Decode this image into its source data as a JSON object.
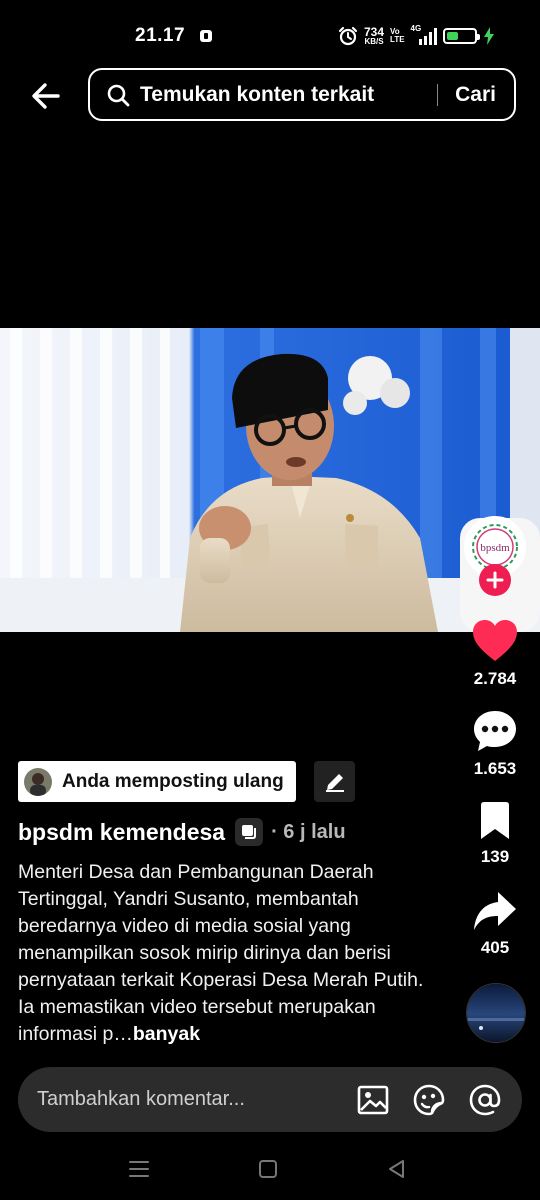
{
  "status_bar": {
    "time": "21.17",
    "net_speed_value": "734",
    "net_speed_unit": "KB/S",
    "volte_top": "Vo",
    "volte_bottom": "LTE",
    "network": "4G",
    "battery_level": 0.45,
    "battery_color": "#3fd35a",
    "icons": [
      "app-notification-icon",
      "alarm-icon",
      "signal-icon",
      "battery-icon",
      "charging-icon"
    ]
  },
  "search": {
    "text": "Temukan konten terkait",
    "button_label": "Cari"
  },
  "profile": {
    "avatar_text": "bpsdm"
  },
  "actions": {
    "likes": "2.784",
    "comments": "1.653",
    "saves": "139",
    "shares": "405"
  },
  "post": {
    "repost_label": "Anda memposting ulang",
    "username": "bpsdm kemendesa",
    "time_ago": "· 6 j lalu",
    "caption": "Menteri Desa dan Pembangunan Daerah Tertinggal, Yandri Susanto, membantah beredarnya video di media sosial yang menampilkan sosok mirip dirinya dan berisi pernyataan terkait Koperasi Desa Merah Putih. Ia memastikan video tersebut merupakan informasi p…",
    "more_label": "banyak"
  },
  "comment": {
    "placeholder": "Tambahkan komentar..."
  },
  "colors": {
    "like_red": "#fe2c55",
    "follow_pink": "#ee1d52",
    "background": "#000000"
  }
}
